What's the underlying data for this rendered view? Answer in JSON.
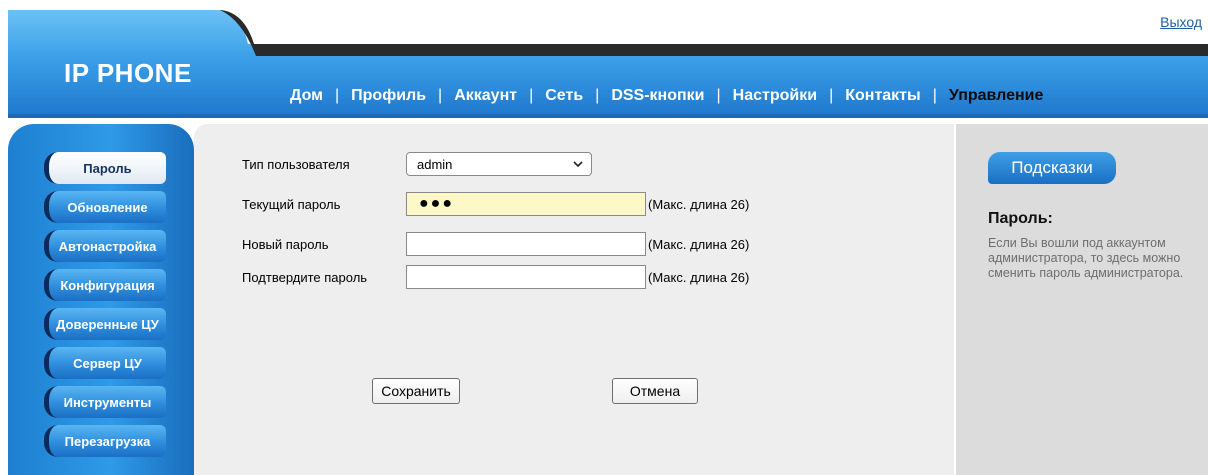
{
  "header": {
    "brand": "IP PHONE",
    "logout": "Выход",
    "nav": [
      {
        "label": "Дом",
        "active": false
      },
      {
        "label": "Профиль",
        "active": false
      },
      {
        "label": "Аккаунт",
        "active": false
      },
      {
        "label": "Сеть",
        "active": false
      },
      {
        "label": "DSS-кнопки",
        "active": false
      },
      {
        "label": "Настройки",
        "active": false
      },
      {
        "label": "Контакты",
        "active": false
      },
      {
        "label": "Управление",
        "active": true
      }
    ],
    "nav_separator": "|"
  },
  "sidebar": {
    "items": [
      {
        "label": "Пароль",
        "active": true
      },
      {
        "label": "Обновление",
        "active": false
      },
      {
        "label": "Автонастройка",
        "active": false
      },
      {
        "label": "Конфигурация",
        "active": false
      },
      {
        "label": "Доверенные ЦУ",
        "active": false
      },
      {
        "label": "Сервер ЦУ",
        "active": false
      },
      {
        "label": "Инструменты",
        "active": false
      },
      {
        "label": "Перезагрузка",
        "active": false
      }
    ]
  },
  "form": {
    "user_type": {
      "label": "Тип пользователя",
      "value": "admin"
    },
    "current_password": {
      "label": "Текущий пароль",
      "value": "●●●",
      "hint": "(Макс. длина 26)"
    },
    "new_password": {
      "label": "Новый пароль",
      "value": "",
      "hint": "(Макс. длина 26)"
    },
    "confirm_password": {
      "label": "Подтвердите пароль",
      "value": "",
      "hint": "(Макс. длина 26)"
    },
    "save_label": "Сохранить",
    "cancel_label": "Отмена"
  },
  "help": {
    "tab_label": "Подсказки",
    "title": "Пароль:",
    "text": "Если Вы вошли под аккаунтом администратора, то здесь можно сменить пароль администратора."
  },
  "icons": {
    "select_arrow": "chevron-down-icon"
  },
  "colors": {
    "brand_blue": "#2e8ddd",
    "dark_navy": "#0b2c5a",
    "active_nav": "#0a0a0a",
    "input_filled_bg": "#fdf8c7"
  }
}
